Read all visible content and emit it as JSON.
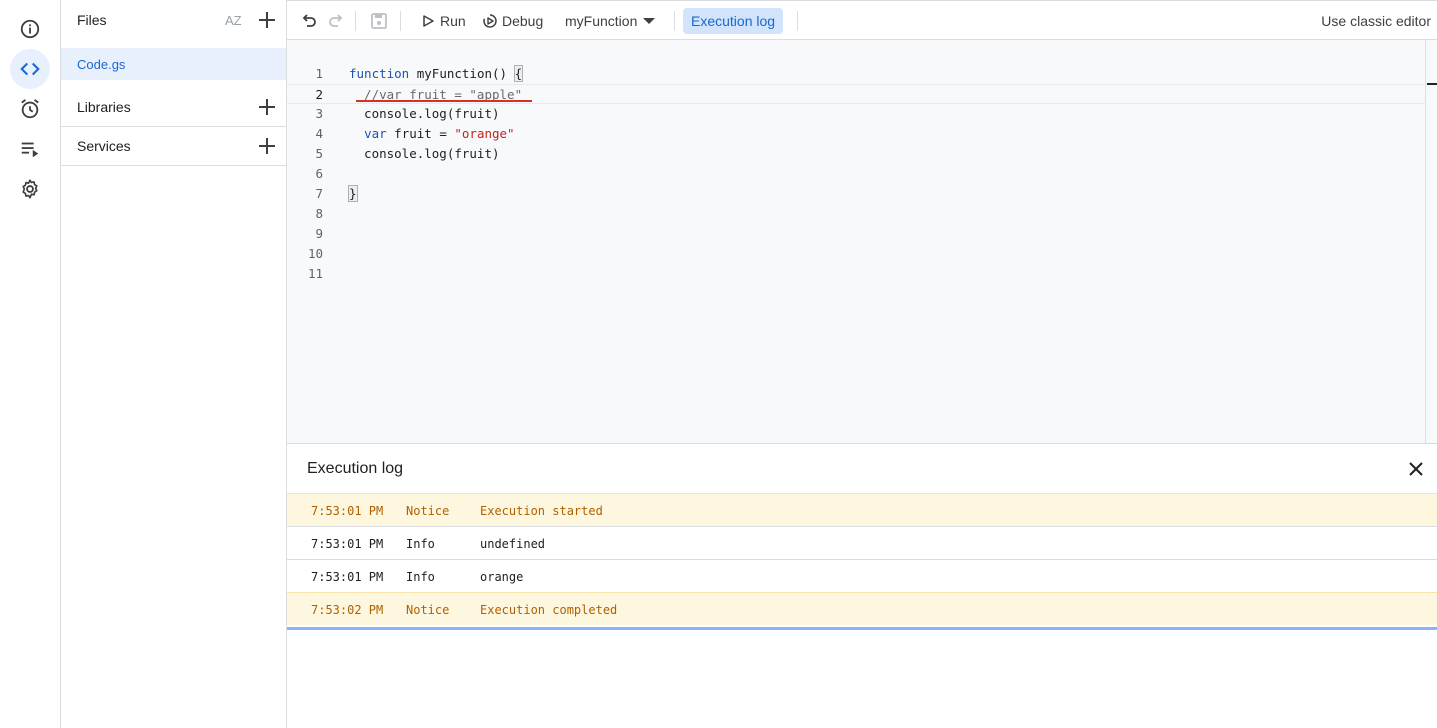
{
  "rail": {
    "items": [
      {
        "name": "overview",
        "icon": "info-icon"
      },
      {
        "name": "editor",
        "icon": "code-icon",
        "active": true
      },
      {
        "name": "triggers",
        "icon": "alarm-clock-icon"
      },
      {
        "name": "executions",
        "icon": "executions-list-icon"
      },
      {
        "name": "settings",
        "icon": "gear-icon"
      }
    ]
  },
  "files": {
    "title": "Files",
    "sort_icon_label": "AZ",
    "selected_file": "Code.gs",
    "sections": [
      {
        "label": "Libraries"
      },
      {
        "label": "Services"
      }
    ]
  },
  "toolbar": {
    "run_label": "Run",
    "debug_label": "Debug",
    "function_name": "myFunction",
    "execution_log_label": "Execution log",
    "classic_editor_label": "Use classic editor"
  },
  "editor": {
    "current_line": 2,
    "line_numbers": [
      "1",
      "2",
      "3",
      "4",
      "5",
      "6",
      "7",
      "8",
      "9",
      "10",
      "11"
    ],
    "lines": [
      "function myFunction() {",
      "  //var fruit = \"apple\"",
      "  console.log(fruit)",
      "  var fruit = \"orange\"",
      "  console.log(fruit)",
      "",
      "}",
      "",
      "",
      "",
      ""
    ]
  },
  "log": {
    "title": "Execution log",
    "rows": [
      {
        "time": "7:53:01 PM",
        "level": "Notice",
        "message": "Execution started"
      },
      {
        "time": "7:53:01 PM",
        "level": "Info",
        "message": "undefined"
      },
      {
        "time": "7:53:01 PM",
        "level": "Info",
        "message": "orange"
      },
      {
        "time": "7:53:02 PM",
        "level": "Notice",
        "message": "Execution completed"
      }
    ]
  },
  "colors": {
    "accent": "#1967d2",
    "active_bg": "#e8f0fe",
    "notice_bg": "#fef7e0",
    "notice_text": "#b06000",
    "error_underline": "#d93025"
  }
}
